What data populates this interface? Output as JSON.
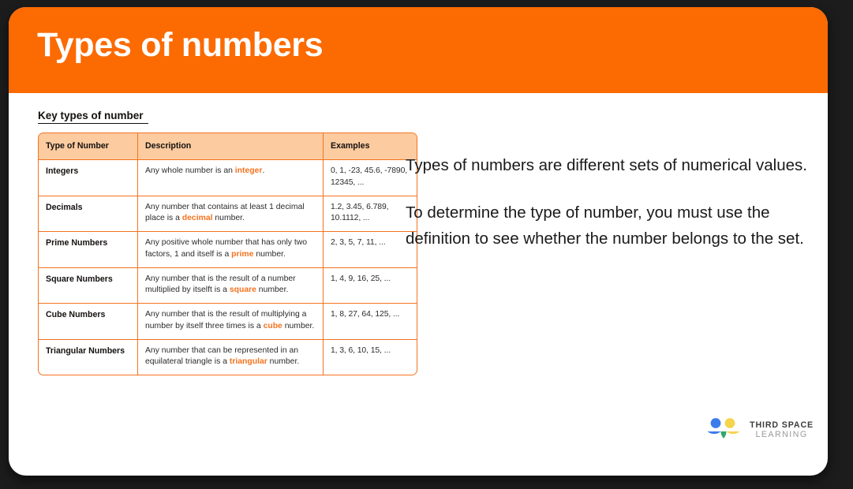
{
  "header": {
    "title": "Types of numbers",
    "background_color": "#fc6a02",
    "text_color": "#ffffff"
  },
  "section": {
    "heading": "Key types of number"
  },
  "table": {
    "accent_color": "#f4731f",
    "header_fill": "#fccba0",
    "columns": [
      "Type of Number",
      "Description",
      "Examples"
    ],
    "rows": [
      {
        "type": "Integers",
        "description_parts": [
          {
            "text": "Any whole number is an ",
            "highlight": false
          },
          {
            "text": "integer",
            "highlight": true
          },
          {
            "text": ".",
            "highlight": false
          }
        ],
        "description_plain": "Any whole number is an integer.",
        "examples": "0, 1, -23, 45.6, -7890, 12345, ..."
      },
      {
        "type": "Decimals",
        "description_parts": [
          {
            "text": "Any number that contains at least 1 decimal place is a ",
            "highlight": false
          },
          {
            "text": "decimal",
            "highlight": true
          },
          {
            "text": " number.",
            "highlight": false
          }
        ],
        "description_plain": "Any number that contains at least 1 decimal place is a decimal number.",
        "examples": "1.2, 3.45, 6.789, 10.1112, ..."
      },
      {
        "type": "Prime Numbers",
        "description_parts": [
          {
            "text": "Any positive whole number that has only two factors, 1 and itself is a ",
            "highlight": false
          },
          {
            "text": "prime",
            "highlight": true
          },
          {
            "text": " number.",
            "highlight": false
          }
        ],
        "description_plain": "Any positive whole number that has only two factors, 1 and itself is a prime number.",
        "examples": "2, 3, 5, 7, 11, ..."
      },
      {
        "type": "Square Numbers",
        "description_parts": [
          {
            "text": "Any number that is the result of a number multiplied by itselft is a ",
            "highlight": false
          },
          {
            "text": "square",
            "highlight": true
          },
          {
            "text": " number.",
            "highlight": false
          }
        ],
        "description_plain": "Any number that is the result of a number multiplied by itselft is a square number.",
        "examples": "1, 4, 9, 16, 25, ..."
      },
      {
        "type": "Cube Numbers",
        "description_parts": [
          {
            "text": "Any number that is the result of multiplying a number by itself three times is a ",
            "highlight": false
          },
          {
            "text": "cube",
            "highlight": true
          },
          {
            "text": " number.",
            "highlight": false
          }
        ],
        "description_plain": "Any number that is the result of multiplying a number by itself three times is a cube number.",
        "examples": "1, 8, 27, 64, 125, ..."
      },
      {
        "type": "Triangular Numbers",
        "description_parts": [
          {
            "text": "Any number that can be represented in an equilateral triangle is a ",
            "highlight": false
          },
          {
            "text": "triangular",
            "highlight": true
          },
          {
            "text": " number.",
            "highlight": false
          }
        ],
        "description_plain": "Any number that can be represented in an equilateral triangle is a triangular number.",
        "examples": "1, 3, 6, 10, 15, ..."
      }
    ]
  },
  "explanation": {
    "paragraphs": [
      "Types of numbers are different sets of numerical values.",
      "To determine the type of number, you must use the definition to see whether the number belongs to the set."
    ]
  },
  "logo": {
    "name": "third-space-learning-logo",
    "line1": "THIRD SPACE",
    "line2": "LEARNING",
    "colors": {
      "blue": "#3a7cec",
      "yellow": "#f5d44e",
      "green": "#2fa86a"
    }
  }
}
